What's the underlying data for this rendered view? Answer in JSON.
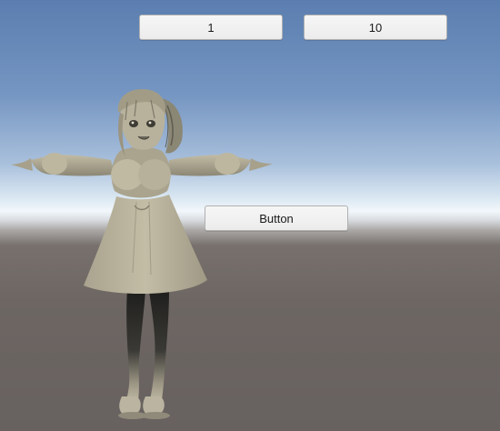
{
  "buttons": {
    "first_label": "1",
    "second_label": "10",
    "main_label": "Button"
  },
  "colors": {
    "sky_top": "#5b7eb0",
    "horizon": "#f2f7fb",
    "ground": "#6d6662",
    "model": "#b6b09a"
  },
  "scene": {
    "character_icon": "t-pose-character-model"
  }
}
